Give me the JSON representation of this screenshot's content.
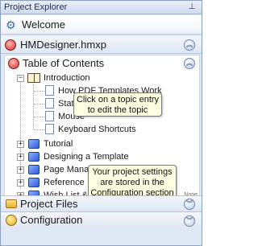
{
  "panel": {
    "title": "Project Explorer",
    "pin_glyph": "⊥"
  },
  "welcome": {
    "label": "Welcome"
  },
  "project": {
    "label": "HMDesigner.hmxp"
  },
  "toc": {
    "label": "Table of Contents"
  },
  "tree": {
    "introduction": "Introduction",
    "topics": [
      "How PDF Templates Work",
      "Static",
      "Mouse",
      "Keyboard Shortcuts"
    ],
    "sections": [
      "Tutorial",
      "Designing a Template",
      "Page Management",
      "Reference",
      "Wish List & In"
    ]
  },
  "tooltips": {
    "topic": "Click on a topic entry to edit the topic",
    "settings": "Your project settings are stored in the Configuration section"
  },
  "none_label": "None",
  "bottom": {
    "project_files": "Project Files",
    "configuration": "Configuration"
  },
  "glyphs": {
    "collapse": "︽",
    "expand": "︾",
    "plus": "+",
    "minus": "−"
  }
}
